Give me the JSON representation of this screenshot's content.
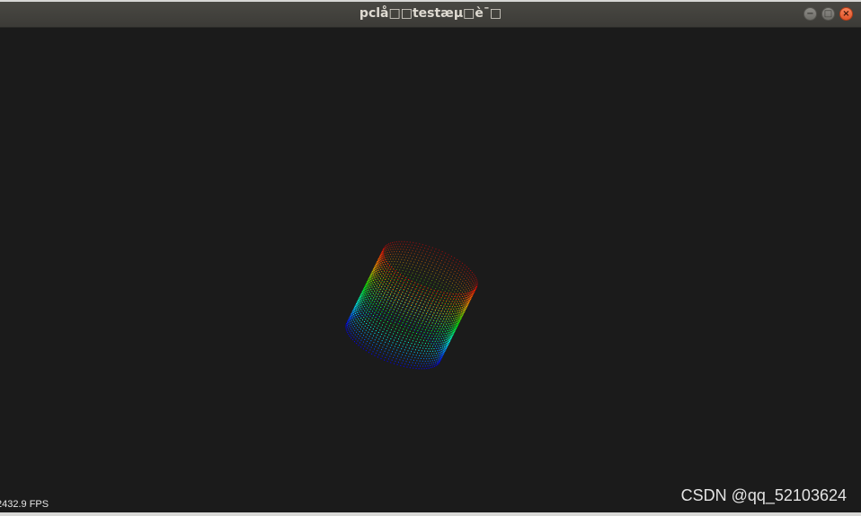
{
  "window": {
    "title": "pclå□□testæµ□è¯□",
    "buttons": {
      "minimize_icon": "minimize-icon",
      "maximize_icon": "maximize-icon",
      "close_icon": "close-icon"
    }
  },
  "viewer": {
    "background_color": "#1b1b1b",
    "point_cloud": {
      "shape": "cylinder",
      "colormap": [
        "#ff0000",
        "#ffa500",
        "#00ff00",
        "#00ffff",
        "#0000ff"
      ]
    },
    "fps_text": "2432.9 FPS"
  },
  "watermark": "CSDN @qq_52103624"
}
